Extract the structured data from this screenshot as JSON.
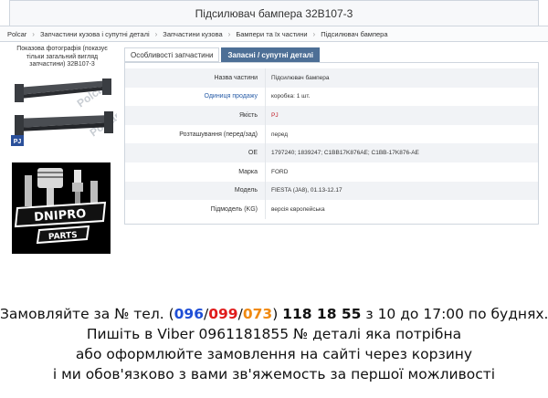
{
  "page": {
    "title": "Підсилювач бампера 32B107-3"
  },
  "breadcrumb": [
    "Polcar",
    "Запчастини кузова і супутні деталі",
    "Запчастини кузова",
    "Бампери та їх частини",
    "Підсилювач бампера"
  ],
  "breadcrumb_separator": "›",
  "photo": {
    "caption": "Показова фотографія (показує тільки загальний вигляд запчастини) 32B107-3",
    "badge": "PJ",
    "watermark": "Polcar"
  },
  "logo": {
    "line1": "DNIPRO",
    "line2": "PARTS"
  },
  "tabs": [
    {
      "label": "Особливості запчастини",
      "active": false
    },
    {
      "label": "Запасні / супутні деталі",
      "active": true
    }
  ],
  "specs": [
    {
      "label": "Назва частини",
      "value": "Підсилювач бампера"
    },
    {
      "label": "Одиниця продажу",
      "value": "коробка: 1 шт."
    },
    {
      "label": "Якість",
      "value": "PJ"
    },
    {
      "label": "Розташування (перед/зад)",
      "value": "перед"
    },
    {
      "label": "OE",
      "value": "1797240; 1839247; C1BB17K876AE; C1BB-17K876-AE"
    },
    {
      "label": "Марка",
      "value": "FORD"
    },
    {
      "label": "Модель",
      "value": "FIESTA (JA8), 01.13-12.17"
    },
    {
      "label": "Підмодель (KG)",
      "value": "версія європейська"
    }
  ],
  "contact": {
    "l1_prefix": "Замовляйте за № тел. (",
    "code1": "096",
    "slash": "/",
    "code2": "099",
    "code3": "073",
    "l1_close": ") ",
    "number": "118 18 55",
    "l1_suffix": " з 10 до 17:00 по буднях.",
    "l2": "Пишіть в Viber 0961181855 № деталі яка потрібна",
    "l3": "або оформлюйте замовлення на сайті через корзину",
    "l4": "і ми обов'язково з вами зв'яжемость за першої можливості"
  },
  "colors": {
    "tab_active": "#4d6f96",
    "link": "#2a5ea8",
    "quality_red": "#c0202a",
    "code_blue": "#1f4fd6",
    "code_red": "#e01b1b",
    "code_orange": "#f08a12"
  }
}
